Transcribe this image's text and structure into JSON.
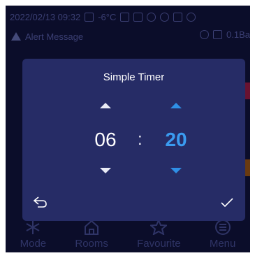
{
  "status_bar": {
    "datetime": "2022/02/13 09:32",
    "temperature": "-6°C"
  },
  "alert": {
    "message": "Alert Message",
    "reading": "0.1Ba"
  },
  "dialog": {
    "title": "Simple Timer",
    "hours": "06",
    "separator": ":",
    "minutes": "20",
    "accent_color": "#2f8fe6"
  },
  "bottom_nav": {
    "items": [
      {
        "label": "Mode",
        "icon": "snowflake-icon"
      },
      {
        "label": "Rooms",
        "icon": "house-icon"
      },
      {
        "label": "Favourite",
        "icon": "star-icon"
      },
      {
        "label": "Menu",
        "icon": "menu-icon"
      }
    ]
  },
  "icons": {
    "back": "return-arrow-icon",
    "confirm": "check-icon"
  }
}
